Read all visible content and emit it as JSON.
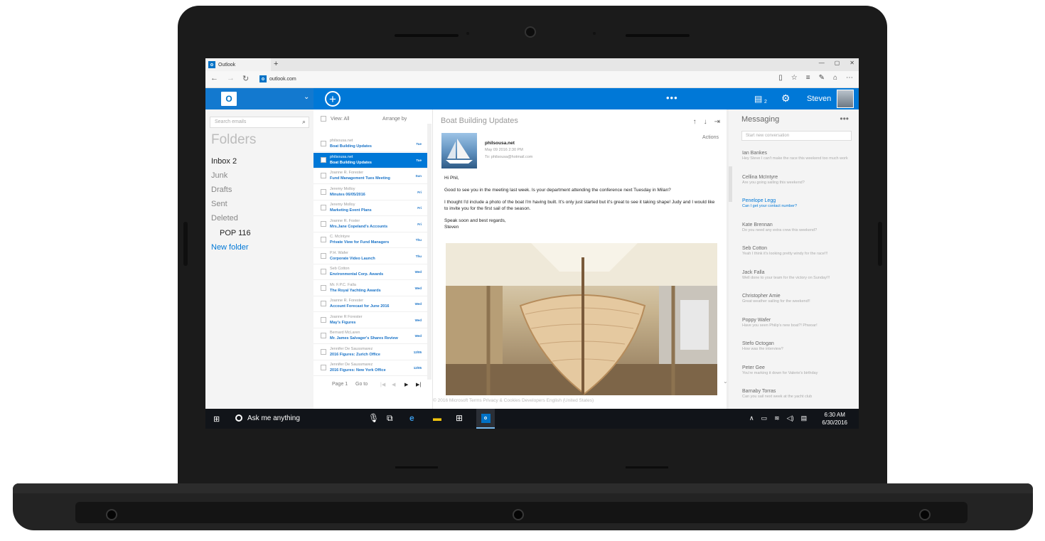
{
  "browser": {
    "tab_title": "Outlook",
    "new_tab": "+",
    "url": "outlook.com",
    "window_controls": [
      "—",
      "▢",
      "✕"
    ]
  },
  "appbar": {
    "chat_count": "2",
    "user_name": "Steven"
  },
  "folders": {
    "search_placeholder": "Search emails",
    "title": "Folders",
    "inbox": "Inbox  2",
    "junk": "Junk",
    "drafts": "Drafts",
    "sent": "Sent",
    "deleted": "Deleted",
    "pop": "POP  116",
    "new_folder": "New folder"
  },
  "message_list": {
    "view_label": "View: All",
    "arrange_label": "Arrange by",
    "items": [
      {
        "from": "philsousa.net",
        "subject": "Boat Building Updates",
        "day": "Tue"
      },
      {
        "from": "philsousa.net",
        "subject": "Boat Building Updates",
        "day": "Tue"
      },
      {
        "from": "Joanne R. Forester",
        "subject": "Fund Management Tues Meeting",
        "day": "Sun"
      },
      {
        "from": "Jeremy Molloy",
        "subject": "Minutes 06/05/2016",
        "day": "Fri"
      },
      {
        "from": "Jeremy Molloy",
        "subject": "Marketing Event Plans",
        "day": "Fri"
      },
      {
        "from": "Joanne R. Foster",
        "subject": "Mrs.Jane Copeland's Accounts",
        "day": "Fri"
      },
      {
        "from": "C. McIntyre",
        "subject": "Private View for Fund Managers",
        "day": "Thu"
      },
      {
        "from": "P.H. Wafer",
        "subject": "Corporate Video Launch",
        "day": "Thu"
      },
      {
        "from": "Seb Cotton",
        "subject": "Environmental Corp. Awards",
        "day": "Wed"
      },
      {
        "from": "Mr. F.P.C. Falla",
        "subject": "The Royal Yachting Awards",
        "day": "Wed"
      },
      {
        "from": "Joanne R. Forester",
        "subject": "Account Forecast for June 2016",
        "day": "Wed"
      },
      {
        "from": "Joanne R Forester",
        "subject": "May's Figures",
        "day": "Wed"
      },
      {
        "from": "Bernard McLaren",
        "subject": "Mr. James Salvager's Shares Review",
        "day": "Wed"
      },
      {
        "from": "Jennifer De Saussmarez",
        "subject": "2016 Figures: Zurich Office",
        "day": "12/05"
      },
      {
        "from": "Jennifer De Saussmarez",
        "subject": "2016 Figures: New York Office",
        "day": "12/05"
      }
    ],
    "page_label": "Page 1",
    "goto_label": "Go to"
  },
  "reader": {
    "title": "Boat Building Updates",
    "actions": "Actions",
    "from": "philsousa.net",
    "date": "May 09 2016 2:30 PM",
    "to": "To: philsousa@hotmail.com",
    "greeting": "Hi Phil,",
    "p1": "Good to see you in the meeting last week. Is your department attending the conference next Tuesday in Milan?",
    "p2": "I thought I'd include a photo of the boat I'm having built. It's only just started but it's great to see it taking shape! Judy and I would like to invite you for the first sail of the season.",
    "signoff": "Speak soon and best regards,",
    "signature": "Steven",
    "footer": "© 2016 Microsoft     Terms     Privacy & Cookies     Developers     English (United States)"
  },
  "messaging": {
    "title": "Messaging",
    "placeholder": "Start new conversation",
    "conversations": [
      {
        "name": "Ian Bankes",
        "msg": "Hey Steve I can't make the race this weekend too much work"
      },
      {
        "name": "Cellina McIntyre",
        "msg": "Are you going sailing this weekend?"
      },
      {
        "name": "Penelope Legg",
        "msg": "Can I get your contact number?"
      },
      {
        "name": "Kate Brennan",
        "msg": "Do you need any extra crew this weekend?"
      },
      {
        "name": "Seb Cotton",
        "msg": "Yeah I think it's looking pretty windy for the race!!!"
      },
      {
        "name": "Jack Falla",
        "msg": "Well done to your team for the victory on Sunday!!!"
      },
      {
        "name": "Christopher Amie",
        "msg": "Great weather sailing for the weekend!!"
      },
      {
        "name": "Poppy Wafer",
        "msg": "Have you seen Philip's new boat?! Phwoar!"
      },
      {
        "name": "Stefo Octogan",
        "msg": "How was the interview?"
      },
      {
        "name": "Peter Gee",
        "msg": "You're marking it down for Valerie's birthday"
      },
      {
        "name": "Barnaby Torras",
        "msg": "Can you sail next week at the yacht club"
      }
    ]
  },
  "taskbar": {
    "cortana": "Ask me anything",
    "time": "6:30 AM",
    "date": "6/30/2016"
  }
}
